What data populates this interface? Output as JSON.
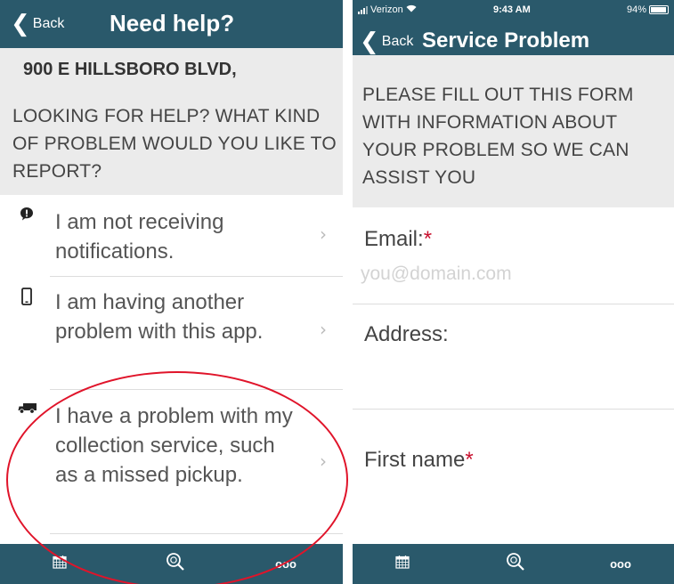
{
  "left_screen": {
    "nav": {
      "back_label": "Back",
      "back_chevron": "❮",
      "title": "Need help?"
    },
    "header": {
      "address": "900 E HILLSBORO BLVD,",
      "prompt": "LOOKING FOR HELP? WHAT KIND OF PROBLEM WOULD YOU LIKE TO REPORT?"
    },
    "items": [
      {
        "icon": "alert-bubble-icon",
        "label": "I am not receiving notifications.",
        "chevron": "›"
      },
      {
        "icon": "phone-icon",
        "label": "I am having another problem with this app.",
        "chevron": "›"
      },
      {
        "icon": "truck-icon",
        "label": "I have a problem with my collection service, such as a missed pickup.",
        "chevron": "›"
      }
    ],
    "tabbar": {
      "tabs": [
        "calendar-icon",
        "search-recycle-icon",
        "more-icon"
      ],
      "more_label": "ooo"
    }
  },
  "right_screen": {
    "status": {
      "carrier": "Verizon",
      "time": "9:43 AM",
      "battery": "94%",
      "battery_level": 0.94
    },
    "nav": {
      "back_label": "Back",
      "back_chevron": "❮",
      "title": "Service Problem"
    },
    "header": {
      "prompt": "PLEASE FILL OUT THIS FORM WITH INFORMATION ABOUT YOUR PROBLEM SO WE CAN ASSIST YOU"
    },
    "form": {
      "email_label": "Email:",
      "email_placeholder": "you@domain.com",
      "address_label": "Address:",
      "first_name_label": "First name",
      "required_mark": "*"
    },
    "tabbar": {
      "tabs": [
        "calendar-icon",
        "search-recycle-icon",
        "more-icon"
      ],
      "more_label": "ooo"
    }
  },
  "colors": {
    "nav_bg": "#2a596b",
    "header_bg": "#ebebeb",
    "required": "#c8102e",
    "annotation": "#e0142a"
  }
}
